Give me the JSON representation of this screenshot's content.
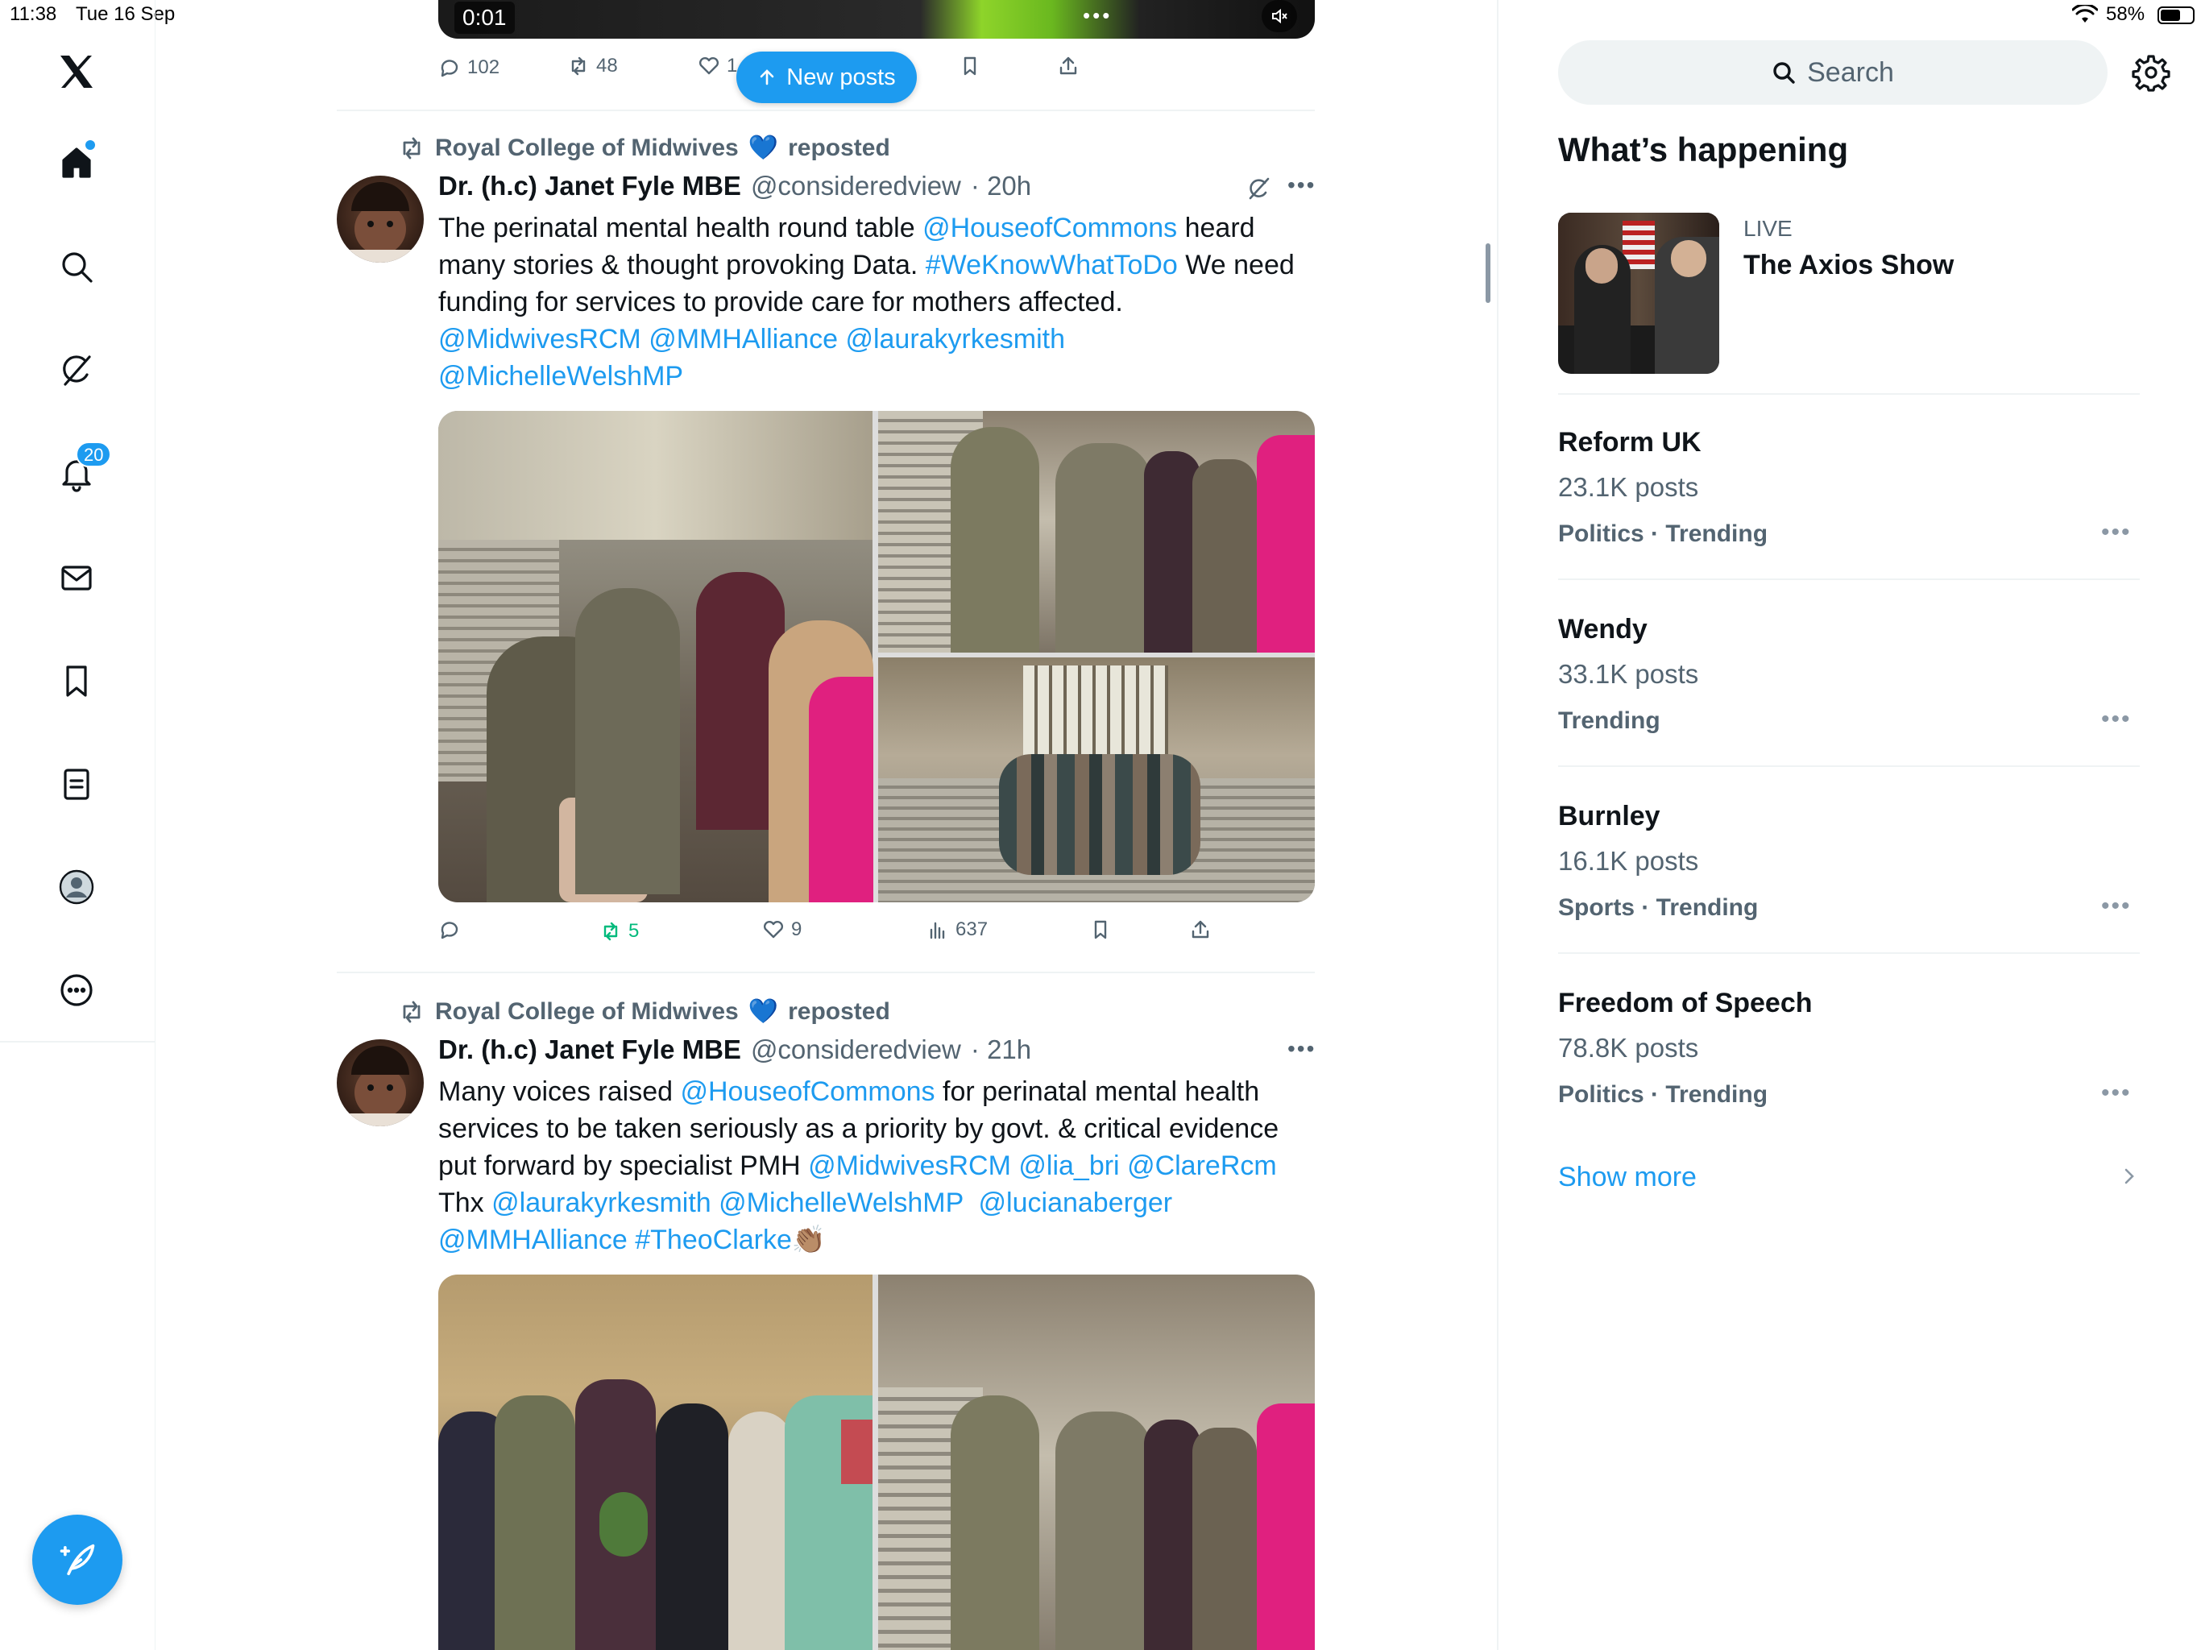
{
  "status_bar": {
    "time": "11:38",
    "date": "Tue 16 Sep",
    "battery": "58%"
  },
  "sidebar": {
    "items": [
      {
        "name": "home"
      },
      {
        "name": "explore"
      },
      {
        "name": "grok"
      },
      {
        "name": "notifications",
        "badge": "20"
      },
      {
        "name": "messages"
      },
      {
        "name": "bookmarks"
      },
      {
        "name": "lists"
      },
      {
        "name": "profile"
      },
      {
        "name": "more"
      }
    ]
  },
  "top_post": {
    "video_time": "0:01",
    "replies": "102",
    "reposts": "48",
    "likes": "1"
  },
  "new_posts_label": "New posts",
  "posts": [
    {
      "reposted_by": "Royal College of Midwives",
      "reposted_label": "reposted",
      "author": "Dr. (h.c) Janet Fyle MBE",
      "handle": "@consideredview",
      "time": "· 20h",
      "text": [
        [
          {
            "t": "The perinatal mental health round table "
          },
          {
            "l": "@HouseofCommons"
          },
          {
            "t": " heard"
          }
        ],
        [
          {
            "t": "many stories & thought provoking Data. "
          },
          {
            "l": "#WeKnowWhatToDo"
          },
          {
            "t": " We need"
          }
        ],
        [
          {
            "t": "funding for services to provide care for mothers affected."
          }
        ],
        [
          {
            "l": "@MidwivesRCM"
          },
          {
            "t": " "
          },
          {
            "l": "@MMHAlliance"
          },
          {
            "t": " "
          },
          {
            "l": "@laurakyrkesmith"
          }
        ],
        [
          {
            "l": "@MichelleWelshMP"
          }
        ]
      ],
      "replies": "",
      "reposts": "5",
      "likes": "9",
      "views": "637"
    },
    {
      "reposted_by": "Royal College of Midwives",
      "reposted_label": "reposted",
      "author": "Dr. (h.c) Janet Fyle MBE",
      "handle": "@consideredview",
      "time": "· 21h",
      "text": [
        [
          {
            "t": "Many voices raised "
          },
          {
            "l": "@HouseofCommons"
          },
          {
            "t": " for perinatal mental health"
          }
        ],
        [
          {
            "t": "services to be taken seriously as a priority by govt. & critical evidence"
          }
        ],
        [
          {
            "t": "put forward by specialist PMH "
          },
          {
            "l": "@MidwivesRCM"
          },
          {
            "t": " "
          },
          {
            "l": "@lia_bri"
          },
          {
            "t": " "
          },
          {
            "l": "@ClareRcm"
          }
        ],
        [
          {
            "t": "Thx "
          },
          {
            "l": "@laurakyrkesmith"
          },
          {
            "t": " "
          },
          {
            "l": "@MichelleWelshMP"
          },
          {
            "t": "  "
          },
          {
            "l": "@lucianaberger"
          }
        ],
        [
          {
            "l": "@MMHAlliance"
          },
          {
            "t": " "
          },
          {
            "l": "#TheoClarke"
          },
          {
            "t": "👏🏽"
          }
        ]
      ]
    }
  ],
  "right": {
    "search_placeholder": "Search",
    "whats_happening": "What’s happening",
    "live": {
      "label": "LIVE",
      "title": "The Axios Show"
    },
    "trends": [
      {
        "name": "Reform UK",
        "count": "23.1K posts",
        "meta": "Politics · Trending"
      },
      {
        "name": "Wendy",
        "count": "33.1K posts",
        "meta": "Trending"
      },
      {
        "name": "Burnley",
        "count": "16.1K posts",
        "meta": "Sports · Trending"
      },
      {
        "name": "Freedom of Speech",
        "count": "78.8K posts",
        "meta": "Politics · Trending"
      }
    ],
    "show_more": "Show more"
  },
  "colors": {
    "accent": "#1d9bf0",
    "text": "#0f1419",
    "secondary": "#536471",
    "repost_green": "#00ba7c"
  }
}
